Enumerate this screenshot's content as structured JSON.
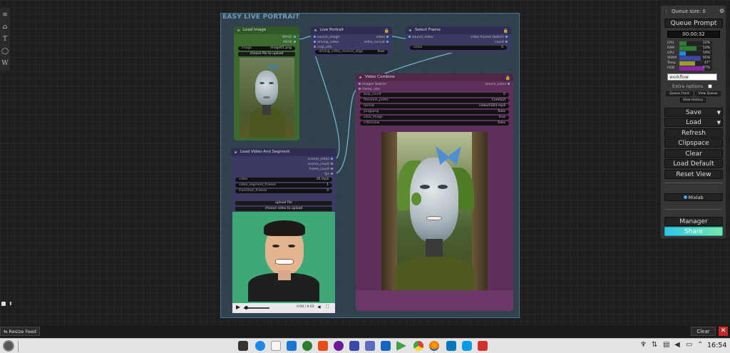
{
  "left_toolbar": {
    "items": [
      {
        "name": "menu-icon",
        "glyph": "≡"
      },
      {
        "name": "home-icon",
        "glyph": "⌂"
      },
      {
        "name": "text-icon",
        "glyph": "T"
      },
      {
        "name": "circle-icon",
        "glyph": "◯"
      },
      {
        "name": "w-icon",
        "glyph": "W"
      }
    ]
  },
  "group": {
    "title": "EASY LIVE PORTRAIT"
  },
  "nodes": {
    "load_image": {
      "title": "Load Image",
      "outputs": [
        "IMAGE",
        "MASK"
      ],
      "image_widget_label": "image",
      "image_widget_value": "image01.png",
      "upload_button": "choose file to upload"
    },
    "live_portrait": {
      "title": "Live Portrait",
      "inputs": [
        "source_image",
        "driving_video",
        "crop_info"
      ],
      "outputs": [
        "video",
        "video_concat"
      ],
      "widget_label": "driving_video_reverse_align",
      "widget_value": "true"
    },
    "select_frame": {
      "title": "Select Frame",
      "input": "source_video",
      "outputs": [
        "video frames (batch)",
        "count"
      ],
      "widget_label": "index",
      "widget_value": "0"
    },
    "video_combine": {
      "title": "Video Combine",
      "inputs": [
        "images (batch)",
        "frame_rate"
      ],
      "output": "source_video",
      "widgets": [
        {
          "label": "loop_count",
          "value": "0"
        },
        {
          "label": "filename_prefix",
          "value": "ComfyUI"
        },
        {
          "label": "format",
          "value": "video/h264-mp4"
        },
        {
          "label": "pingpong",
          "value": "false"
        },
        {
          "label": "save_image",
          "value": "true"
        },
        {
          "label": "crf/review",
          "value": "false"
        }
      ]
    },
    "load_video": {
      "title": "Load Video And Segment",
      "outputs": [
        "scenes_video",
        "scenes_count",
        "frame_count",
        "fps"
      ],
      "widgets": [
        {
          "label": "video",
          "value": "d5.mp4"
        },
        {
          "label": "video_segment_frames",
          "value": "1"
        },
        {
          "label": "transition_frames",
          "value": "0"
        }
      ],
      "upload_button": "upload file",
      "choose_button": "choose video to upload",
      "time_display": "0:00 / 0:03"
    }
  },
  "panel": {
    "queue_size_label": "Queue size: 0",
    "queue_prompt": "Queue Prompt",
    "timer": "00:00:32",
    "monitors": [
      {
        "name": "CPU",
        "value": "22%",
        "fraction": 0.22,
        "color": "#2e7d32"
      },
      {
        "name": "RAM",
        "value": "53%",
        "fraction": 0.53,
        "color": "#2e7d32"
      },
      {
        "name": "GPU",
        "value": "19%",
        "fraction": 0.19,
        "color": "#1e88e5"
      },
      {
        "name": "VRAM",
        "value": "65%",
        "fraction": 0.65,
        "color": "#3949ab"
      },
      {
        "name": "Temp",
        "value": "47°",
        "fraction": 0.47,
        "color": "#9e9d24"
      },
      {
        "name": "HDD",
        "value": "77%",
        "fraction": 0.77,
        "color": "#8e24aa"
      }
    ],
    "workflow_input": "workflow",
    "extra_options": "Extra options",
    "queue_front": "Queue Front",
    "view_queue": "View Queue",
    "view_history": "View History",
    "save": "Save",
    "load": "Load",
    "refresh": "Refresh",
    "clipspace": "Clipspace",
    "clear": "Clear",
    "load_default": "Load Default",
    "reset_view": "Reset View",
    "mixlab": "Mixlab",
    "manager": "Manager",
    "share": "Share"
  },
  "bottom": {
    "resize_feed": "Resize Feed",
    "clear": "Clear"
  },
  "taskbar": {
    "time": "16:54"
  }
}
